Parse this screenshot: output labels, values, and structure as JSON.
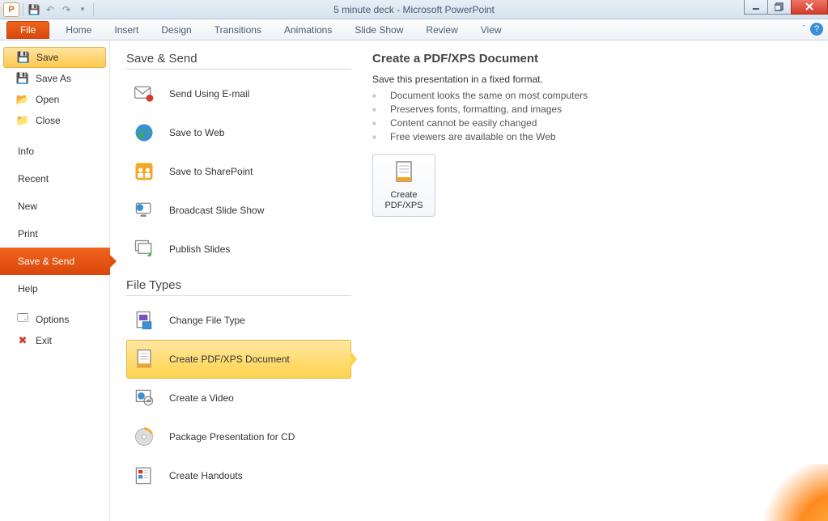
{
  "title": "5 minute deck - Microsoft PowerPoint",
  "ribbon_tabs": {
    "file": "File",
    "home": "Home",
    "insert": "Insert",
    "design": "Design",
    "transitions": "Transitions",
    "animations": "Animations",
    "slideshow": "Slide Show",
    "review": "Review",
    "view": "View"
  },
  "sidebar": {
    "save": "Save",
    "save_as": "Save As",
    "open": "Open",
    "close": "Close",
    "info": "Info",
    "recent": "Recent",
    "new": "New",
    "print": "Print",
    "save_send": "Save & Send",
    "help": "Help",
    "options": "Options",
    "exit": "Exit"
  },
  "mid": {
    "section1": "Save & Send",
    "items1": {
      "email": "Send Using E-mail",
      "web": "Save to Web",
      "sharepoint": "Save to SharePoint",
      "broadcast": "Broadcast Slide Show",
      "publish": "Publish Slides"
    },
    "section2": "File Types",
    "items2": {
      "changetype": "Change File Type",
      "pdfxps": "Create PDF/XPS Document",
      "video": "Create a Video",
      "package": "Package Presentation for CD",
      "handouts": "Create Handouts"
    }
  },
  "right": {
    "heading": "Create a PDF/XPS Document",
    "sub": "Save this presentation in a fixed format.",
    "bullets": [
      "Document looks the same on most computers",
      "Preserves fonts, formatting, and images",
      "Content cannot be easily changed",
      "Free viewers are available on the Web"
    ],
    "button_line1": "Create",
    "button_line2": "PDF/XPS"
  }
}
